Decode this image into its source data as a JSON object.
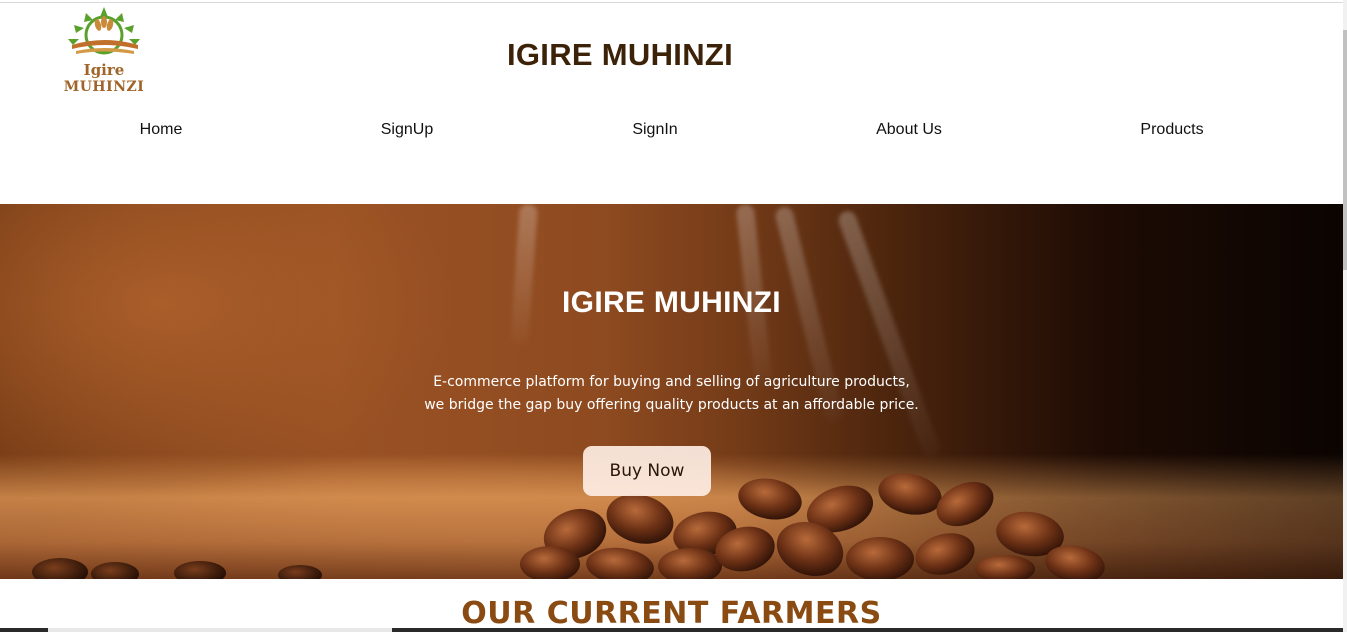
{
  "header": {
    "logo": {
      "icon": "wheat-sun-logo-icon",
      "line1": "Igire",
      "line2": "MUHINZI"
    },
    "title": "IGIRE MUHINZI"
  },
  "nav": {
    "items": [
      {
        "label": "Home"
      },
      {
        "label": "SignUp"
      },
      {
        "label": "SignIn"
      },
      {
        "label": "About Us"
      },
      {
        "label": "Products"
      }
    ]
  },
  "hero": {
    "title": "IGIRE MUHINZI",
    "line1": "E-commerce platform for buying and selling of agriculture products,",
    "line2": "we bridge the gap buy offering quality products at an affordable price.",
    "button_label": "Buy Now",
    "background": "coffee-beans-image"
  },
  "sections": {
    "farmers_heading": "OUR CURRENT FARMERS"
  },
  "colors": {
    "title_brown": "#3b2208",
    "heading_brown": "#8a4b12",
    "logo_brown": "#a0642a",
    "logo_green": "#5aa02c"
  }
}
